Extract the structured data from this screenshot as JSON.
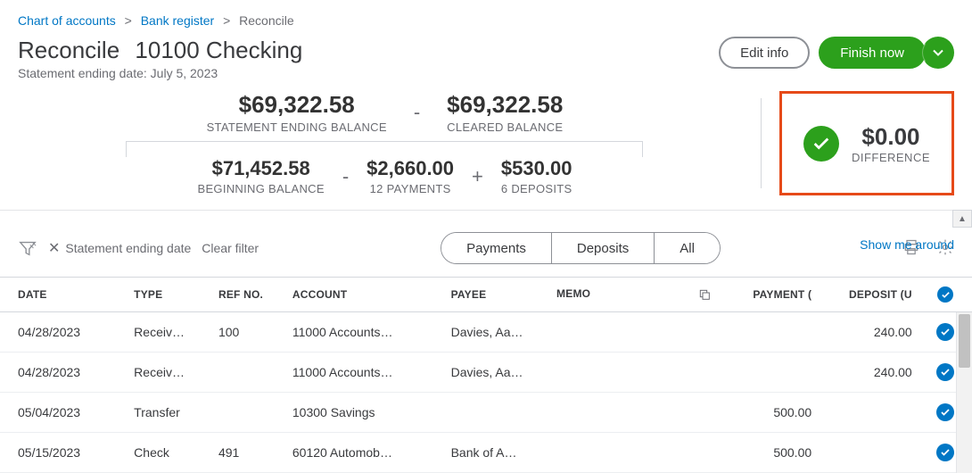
{
  "breadcrumb": {
    "chart": "Chart of accounts",
    "register": "Bank register",
    "current": "Reconcile"
  },
  "title": {
    "main": "Reconcile",
    "account": "10100 Checking",
    "statement_prefix": "Statement ending date: ",
    "statement_date": "July 5, 2023"
  },
  "actions": {
    "edit": "Edit info",
    "finish": "Finish now"
  },
  "summary": {
    "ending_amount": "$69,322.58",
    "ending_label": "STATEMENT ENDING BALANCE",
    "cleared_amount": "$69,322.58",
    "cleared_label": "CLEARED BALANCE",
    "beginning_amount": "$71,452.58",
    "beginning_label": "BEGINNING BALANCE",
    "payments_amount": "$2,660.00",
    "payments_label": "12 PAYMENTS",
    "deposits_amount": "$530.00",
    "deposits_label": "6 DEPOSITS",
    "difference_amount": "$0.00",
    "difference_label": "DIFFERENCE"
  },
  "toolbar": {
    "filter_label": "Statement ending date",
    "clear": "Clear filter",
    "tab_payments": "Payments",
    "tab_deposits": "Deposits",
    "tab_all": "All",
    "show_link": "Show me around"
  },
  "columns": {
    "date": "DATE",
    "type": "TYPE",
    "ref": "REF NO.",
    "account": "ACCOUNT",
    "payee": "PAYEE",
    "memo": "MEMO",
    "payment": "PAYMENT (",
    "deposit": "DEPOSIT (U"
  },
  "rows": [
    {
      "date": "04/28/2023",
      "type": "Receiv…",
      "ref": "100",
      "acct": "11000 Accounts…",
      "payee": "Davies, Aa…",
      "memo": "",
      "payment": "",
      "deposit": "240.00",
      "checked": true
    },
    {
      "date": "04/28/2023",
      "type": "Receiv…",
      "ref": "",
      "acct": "11000 Accounts…",
      "payee": "Davies, Aa…",
      "memo": "",
      "payment": "",
      "deposit": "240.00",
      "checked": true
    },
    {
      "date": "05/04/2023",
      "type": "Transfer",
      "ref": "",
      "acct": "10300 Savings",
      "payee": "",
      "memo": "",
      "payment": "500.00",
      "deposit": "",
      "checked": true
    },
    {
      "date": "05/15/2023",
      "type": "Check",
      "ref": "491",
      "acct": "60120 Automob…",
      "payee": "Bank of A…",
      "memo": "",
      "payment": "500.00",
      "deposit": "",
      "checked": true
    }
  ]
}
